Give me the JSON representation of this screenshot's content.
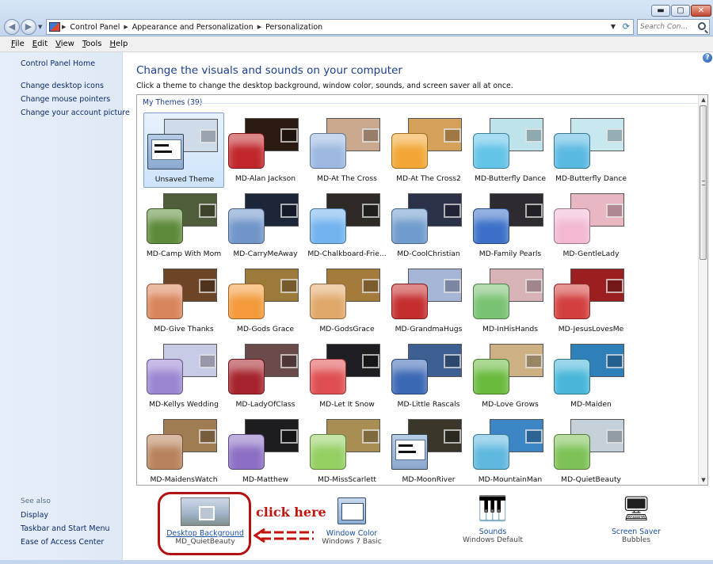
{
  "window": {
    "minimize_glyph": "▬",
    "maximize_glyph": "▢",
    "close_glyph": "✕"
  },
  "nav": {
    "back_glyph": "◀",
    "forward_glyph": "▶",
    "breadcrumbs": [
      "Control Panel",
      "Appearance and Personalization",
      "Personalization"
    ],
    "search_placeholder": "Search Con..."
  },
  "menu": {
    "items": [
      {
        "accel": "F",
        "rest": "ile"
      },
      {
        "accel": "E",
        "rest": "dit"
      },
      {
        "accel": "V",
        "rest": "iew"
      },
      {
        "accel": "T",
        "rest": "ools"
      },
      {
        "accel": "H",
        "rest": "elp"
      }
    ]
  },
  "sidebar": {
    "home": "Control Panel Home",
    "links": [
      "Change desktop icons",
      "Change mouse pointers",
      "Change your account picture"
    ],
    "see_also_title": "See also",
    "see_also": [
      "Display",
      "Taskbar and Start Menu",
      "Ease of Access Center"
    ]
  },
  "main": {
    "title": "Change the visuals and sounds on your computer",
    "description": "Click a theme to change the desktop background, window color, sounds, and screen saver all at once.",
    "help_glyph": "?",
    "group_title": "My Themes (39)"
  },
  "themes": [
    {
      "name": "Unsaved Theme",
      "bg": "#cfdbe8",
      "swatch": "window",
      "selected": true
    },
    {
      "name": "MD-Alan Jackson",
      "bg": "#2a1a12",
      "swatch": "#c0262a"
    },
    {
      "name": "MD-At The Cross",
      "bg": "#c9a88e",
      "swatch": "#9bb8e0"
    },
    {
      "name": "MD-At The Cross2",
      "bg": "#d4a15a",
      "swatch": "#f3a636"
    },
    {
      "name": "MD-Butterfly Dance",
      "bg": "#bfe3ea",
      "swatch": "#63c3e7"
    },
    {
      "name": "MD-Butterfly Dance",
      "bg": "#c7e8ef",
      "swatch": "#5ab9e1"
    },
    {
      "name": "MD-Camp With Mom",
      "bg": "#4f5d3a",
      "swatch": "#5c8a3a"
    },
    {
      "name": "MD-CarryMeAway",
      "bg": "#1d2538",
      "swatch": "#6f95c9"
    },
    {
      "name": "MD-Chalkboard-Frie...",
      "bg": "#2d2a26",
      "swatch": "#73b3ef"
    },
    {
      "name": "MD-CoolChristian",
      "bg": "#2b3148",
      "swatch": "#6f9bcd"
    },
    {
      "name": "MD-Family Pearls",
      "bg": "#2e2b30",
      "swatch": "#3c70c8"
    },
    {
      "name": "MD-GentleLady",
      "bg": "#e8b7c2",
      "swatch": "#f2b8d2"
    },
    {
      "name": "MD-Give Thanks",
      "bg": "#6b4526",
      "swatch": "#d9855c"
    },
    {
      "name": "MD-Gods Grace",
      "bg": "#9c7a3a",
      "swatch": "#f39a3a"
    },
    {
      "name": "MD-GodsGrace",
      "bg": "#a57b3c",
      "swatch": "#e0a86a"
    },
    {
      "name": "MD-GrandmaHugs",
      "bg": "#a4b5d6",
      "swatch": "#c42d2d"
    },
    {
      "name": "MD-InHisHands",
      "bg": "#d7b2b7",
      "swatch": "#78c271"
    },
    {
      "name": "MD-JesusLovesMe",
      "bg": "#9b1f20",
      "swatch": "#d33e3e"
    },
    {
      "name": "MD-Kellys Wedding",
      "bg": "#c8cbe6",
      "swatch": "#9a86d1"
    },
    {
      "name": "MD-LadyOfClass",
      "bg": "#6a4a4a",
      "swatch": "#a5232a"
    },
    {
      "name": "MD-Let It Snow",
      "bg": "#1e1d22",
      "swatch": "#df4f52"
    },
    {
      "name": "MD-Little Rascals",
      "bg": "#3e5f92",
      "swatch": "#3b68b5"
    },
    {
      "name": "MD-Love Grows",
      "bg": "#cdb185",
      "swatch": "#6aba3e"
    },
    {
      "name": "MD-Maiden",
      "bg": "#2f7fb8",
      "swatch": "#47b6d9"
    },
    {
      "name": "MD-MaidensWatch",
      "bg": "#a07c52",
      "swatch": "#b8835c"
    },
    {
      "name": "MD-Matthew",
      "bg": "#1d1d1f",
      "swatch": "#8b6fc4"
    },
    {
      "name": "MD-MissScarlett",
      "bg": "#a98e53",
      "swatch": "#95cf62"
    },
    {
      "name": "MD-MoonRiver",
      "bg": "#3a372a",
      "swatch": "window"
    },
    {
      "name": "MD-MountainMan",
      "bg": "#3d86c5",
      "swatch": "#5fb8df"
    },
    {
      "name": "MD-QuietBeauty",
      "bg": "#c5d0d9",
      "swatch": "#7ec157"
    }
  ],
  "bottom": {
    "desktop_label": "Desktop Background",
    "desktop_sub": "MD_QuietBeauty",
    "window_label": "Window Color",
    "window_sub": "Windows 7 Basic",
    "sounds_label": "Sounds",
    "sounds_sub": "Windows Default",
    "saver_label": "Screen Saver",
    "saver_sub": "Bubbles"
  },
  "annotation": {
    "text": "click here",
    "color": "#c0150e"
  }
}
